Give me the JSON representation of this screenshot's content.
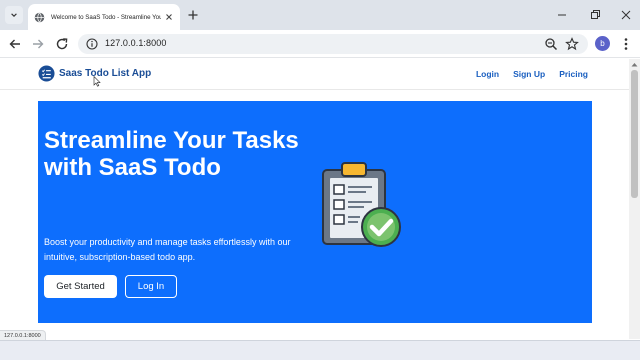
{
  "browser": {
    "tab": {
      "title": "Welcome to SaaS Todo - Streamline Your Tasks"
    },
    "address": {
      "url": "127.0.0.1:8000"
    },
    "profile": {
      "initial": "b"
    },
    "status_url": "127.0.0.1:8000"
  },
  "site": {
    "brand": "Saas Todo List App",
    "nav": [
      {
        "label": "Login"
      },
      {
        "label": "Sign Up"
      },
      {
        "label": "Pricing"
      }
    ]
  },
  "hero": {
    "title": "Streamline Your Tasks with SaaS Todo",
    "subtitle": "Boost your productivity and manage tasks effortlessly with our intuitive, subscription-based todo app.",
    "primary_button": "Get Started",
    "secondary_button": "Log In"
  },
  "colors": {
    "hero_bg": "#0d6efd",
    "brand_text": "#1a4d96",
    "nav_link": "#1a5fc0"
  },
  "icons": {
    "tab_favicon": "globe-icon",
    "illustration": "clipboard-checklist-icon"
  }
}
